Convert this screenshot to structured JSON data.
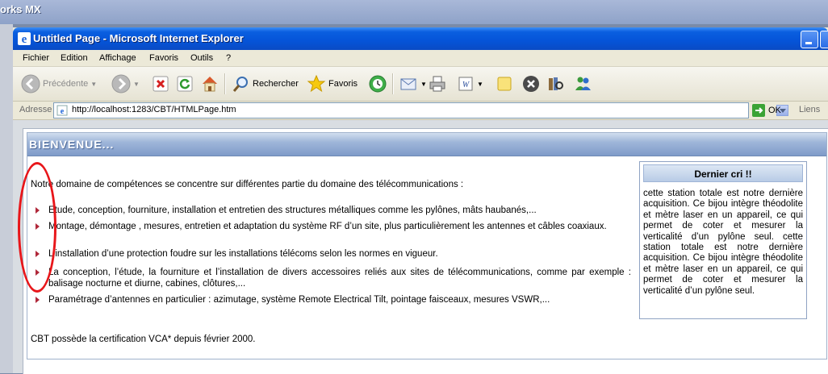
{
  "background_app": {
    "title": "orks MX"
  },
  "window": {
    "title": "Untitled Page - Microsoft Internet Explorer",
    "menu": [
      "Fichier",
      "Edition",
      "Affichage",
      "Favoris",
      "Outils",
      "?"
    ],
    "toolbar": {
      "back": "Précédente",
      "search": "Rechercher",
      "favorites": "Favoris"
    },
    "address": {
      "label": "Adresse",
      "url": "http://localhost:1283/CBT/HTMLPage.htm",
      "go": "OK",
      "links": "Liens"
    }
  },
  "page": {
    "banner": "BIENVENUE...",
    "intro": "Notre domaine de compétences se concentre sur différentes partie du domaine des télécommunications :",
    "bullets": [
      "Etude, conception, fourniture, installation et entretien des structures métalliques comme les pylônes, mâts haubanés,...",
      "Montage, démontage , mesures, entretien et adaptation du système RF d’un site, plus particulièrement les antennes et câbles coaxiaux.",
      "L’installation d’une protection foudre sur les installations télécoms selon les normes en vigueur.",
      "La conception, l’étude, la fourniture et l’installation de divers accessoires reliés aux sites de télécommunications, comme par exemple : balisage nocturne et diurne, cabines, clôtures,...",
      "Paramétrage d’antennes en particulier : azimutage, système Remote Electrical Tilt, pointage faisceaux, mesures VSWR,..."
    ],
    "certification": "CBT possède la certification VCA* depuis février 2000.",
    "sidebar": {
      "title": "Dernier cri !!",
      "text": "cette station totale est notre dernière acquisition. Ce bijou intègre théodolite et mètre laser en un appareil, ce qui permet de coter et mesurer la verticalité d’un pylône seul. cette station totale est notre dernière acquisition. Ce bijou intègre théodolite et mètre laser en un appareil, ce qui permet de coter et mesurer la verticalité d’un pylône seul."
    }
  },
  "colors": {
    "titlebar": "#0554d8",
    "banner": "#7f9bc9",
    "annotation": "#e8161a",
    "bullet": "#b0283a"
  }
}
